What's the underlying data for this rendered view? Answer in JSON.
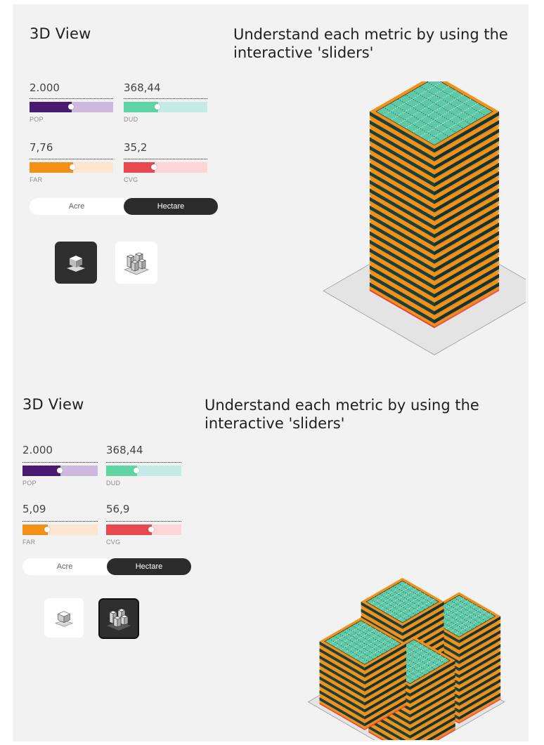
{
  "colors": {
    "pop": [
      "#4a1a70",
      "#cdb9df"
    ],
    "dud": [
      "#5fd5a5",
      "#c5ebe6"
    ],
    "far": [
      "#f39017",
      "#fce6cf"
    ],
    "cvg": [
      "#e84850",
      "#fcd5d7"
    ],
    "accent_orange": "#f39017",
    "floor_red": "#e2413a",
    "tile_teal": "#5ec9a6"
  },
  "panels": [
    {
      "view_title": "3D View",
      "headline_line1": "Understand each metric by using the",
      "headline_line2": "interactive 'sliders'",
      "metrics": {
        "pop": {
          "value": "2.000",
          "label": "POP",
          "level": 0.5
        },
        "dud": {
          "value": "368,44",
          "label": "DUD",
          "level": 0.41
        },
        "far": {
          "value": "7,76",
          "label": "FAR",
          "level": 0.52
        },
        "cvg": {
          "value": "35,2",
          "label": "CVG",
          "level": 0.37
        }
      },
      "units": {
        "acre": "Acre",
        "hectare": "Hectare",
        "selected": "hectare"
      },
      "view_mode": "single-building",
      "icons": {
        "single": "single-cube-icon",
        "cluster": "building-cluster-icon"
      }
    },
    {
      "view_title": "3D View",
      "headline_line1": "Understand each metric by using the",
      "headline_line2": "interactive 'sliders'",
      "metrics": {
        "pop": {
          "value": "2.000",
          "label": "POP",
          "level": 0.5
        },
        "dud": {
          "value": "368,44",
          "label": "DUD",
          "level": 0.41
        },
        "far": {
          "value": "5,09",
          "label": "FAR",
          "level": 0.34
        },
        "cvg": {
          "value": "56,9",
          "label": "CVG",
          "level": 0.61
        }
      },
      "units": {
        "acre": "Acre",
        "hectare": "Hectare",
        "selected": "hectare"
      },
      "view_mode": "building-cluster",
      "icons": {
        "single": "single-cube-icon",
        "cluster": "building-cluster-icon"
      }
    }
  ]
}
